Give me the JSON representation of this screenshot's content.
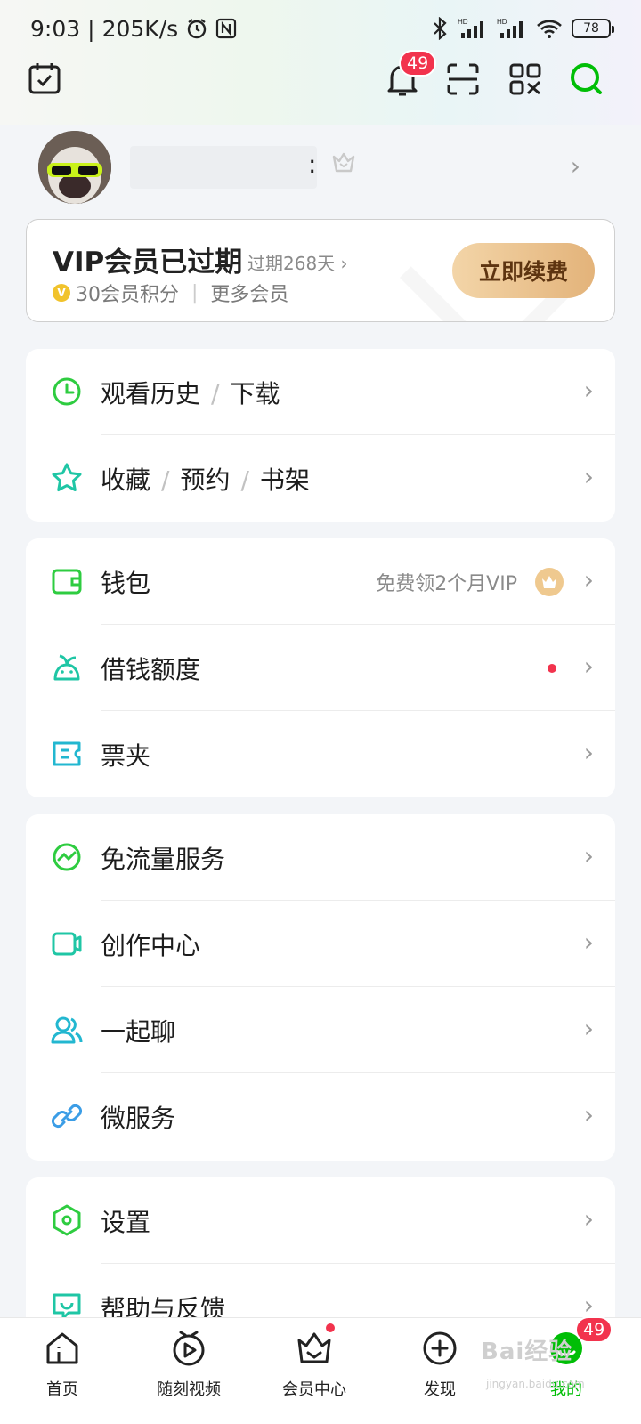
{
  "status_bar": {
    "time": "9:03",
    "net_speed": "205K/s",
    "battery": "78",
    "icons": [
      "alarm-icon",
      "nfc-icon",
      "bluetooth-icon",
      "signal-hd-icon",
      "signal-hd-icon",
      "wifi-icon",
      "battery-icon"
    ]
  },
  "header": {
    "notification_count": "49",
    "icons": [
      "calendar-check-icon",
      "bell-icon",
      "scan-icon",
      "grid-icon",
      "search-icon"
    ]
  },
  "profile": {
    "name_suffix": ":"
  },
  "vip_card": {
    "title": "VIP会员已过期",
    "expired_text": "过期268天",
    "points": "30会员积分",
    "more": "更多会员",
    "renew_button": "立即续费",
    "coin_mark": "V"
  },
  "menu_group_1": [
    {
      "parts": [
        "观看历史",
        "下载"
      ],
      "icon": "clock-icon"
    },
    {
      "parts": [
        "收藏",
        "预约",
        "书架"
      ],
      "icon": "star-icon"
    }
  ],
  "menu_group_2": [
    {
      "label": "钱包",
      "note": "免费领2个月VIP",
      "icon": "wallet-icon"
    },
    {
      "label": "借钱额度",
      "icon": "money-sprout-icon"
    },
    {
      "label": "票夹",
      "icon": "ticket-icon"
    }
  ],
  "menu_group_3": [
    {
      "label": "免流量服务",
      "icon": "traffic-icon"
    },
    {
      "label": "创作中心",
      "icon": "camera-icon"
    },
    {
      "label": "一起聊",
      "icon": "users-icon"
    },
    {
      "label": "微服务",
      "icon": "link-icon"
    }
  ],
  "menu_group_4": [
    {
      "label": "设置",
      "icon": "hexagon-settings-icon"
    },
    {
      "label": "帮助与反馈",
      "icon": "help-chat-icon"
    }
  ],
  "bottom_nav": {
    "tabs": [
      {
        "label": "首页",
        "icon": "home-icon"
      },
      {
        "label": "随刻视频",
        "icon": "play-clock-icon"
      },
      {
        "label": "会员中心",
        "icon": "crown-basket-icon"
      },
      {
        "label": "发现",
        "icon": "plus-circle-icon"
      },
      {
        "label": "我的",
        "icon": "me-icon"
      }
    ],
    "me_badge": "49"
  },
  "watermark": {
    "text": "Bai经验",
    "url": "jingyan.baidu.com"
  },
  "colors": {
    "accent_green": "#00be06",
    "badge_red": "#f2334d",
    "gold": "#e3b37a"
  }
}
